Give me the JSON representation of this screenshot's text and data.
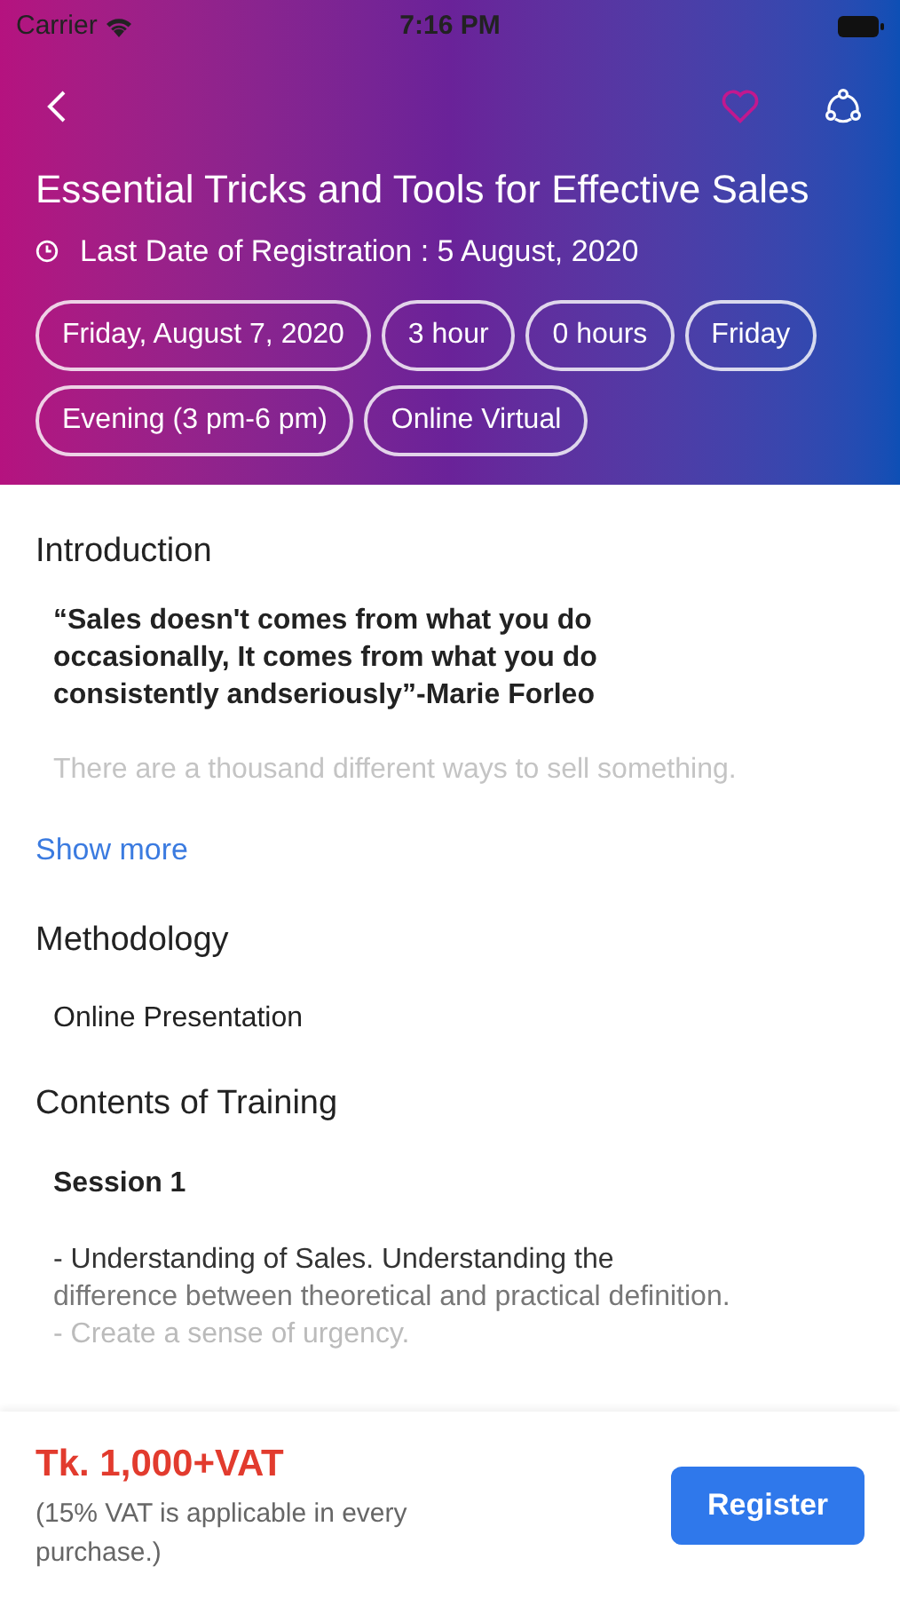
{
  "status_bar": {
    "carrier": "Carrier",
    "time": "7:16 PM"
  },
  "header": {
    "favorite": false,
    "title": "Essential Tricks and Tools for Effective Sales",
    "deadline": "Last Date of Registration : 5 August, 2020",
    "chips": [
      "Friday, August 7, 2020",
      "3 hour",
      "0 hours",
      "Friday",
      "Evening (3 pm-6 pm)",
      "Online Virtual"
    ]
  },
  "introduction": {
    "heading": "Introduction",
    "quote": "“Sales doesn't comes from what you do occasionally, It comes from what you do consistently andseriously”-Marie Forleo",
    "text": "There are a thousand different ways to sell something.",
    "link": "Show more"
  },
  "methodology": {
    "heading": "Methodology",
    "text": "Online Presentation"
  },
  "contents": {
    "heading": "Contents of Training",
    "session": "Session 1",
    "lines": [
      "- Understanding of Sales. Understanding the",
      "difference between theoretical and practical definition.",
      "- Create a sense of urgency."
    ]
  },
  "footer": {
    "price": "Tk. 1,000+VAT",
    "note": "(15% VAT is applicable in every purchase.)",
    "button": "Register"
  }
}
